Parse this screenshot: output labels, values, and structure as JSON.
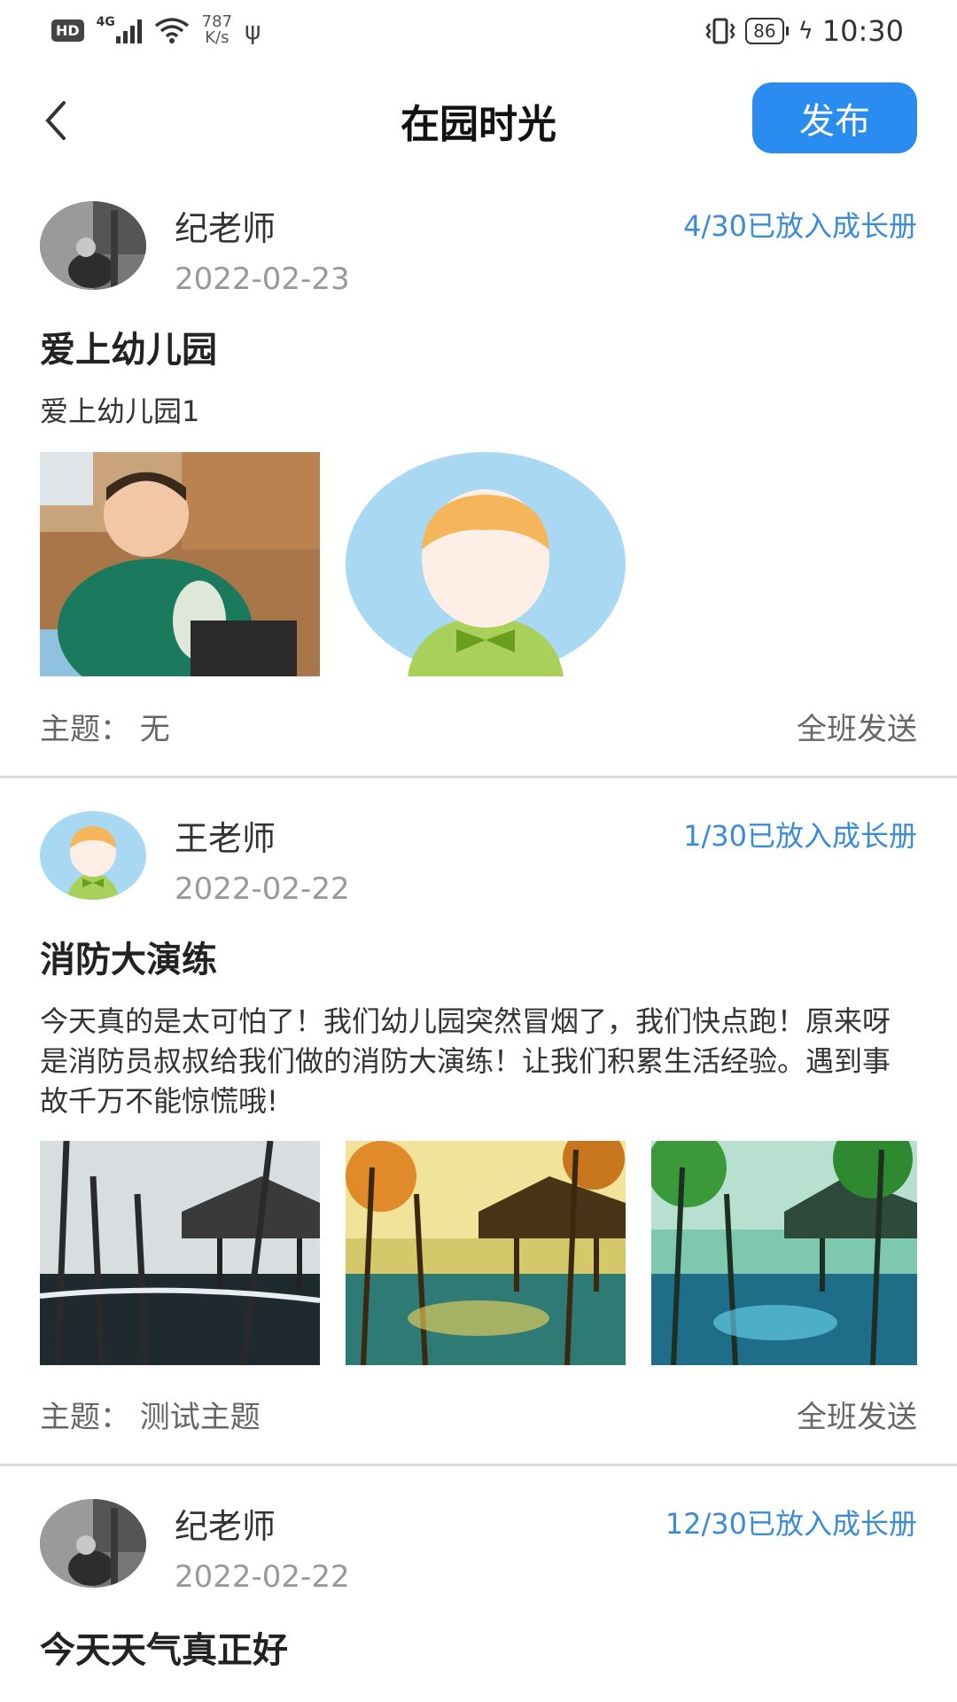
{
  "status_bar": {
    "hd": "HD",
    "network": "4G",
    "speed_value": "787",
    "speed_unit": "K/s",
    "battery": "86",
    "time": "10:30"
  },
  "nav": {
    "title": "在园时光",
    "publish_label": "发布"
  },
  "posts": [
    {
      "author": "纪老师",
      "date": "2022-02-23",
      "growth": "4/30已放入成长册",
      "title": "爱上幼儿园",
      "body": "爱上幼儿园1",
      "topic": "主题：  无",
      "scope": "全班发送"
    },
    {
      "author": "王老师",
      "date": "2022-02-22",
      "growth": "1/30已放入成长册",
      "title": "消防大演练",
      "body": "今天真的是太可怕了！我们幼儿园突然冒烟了，我们快点跑！原来呀是消防员叔叔给我们做的消防大演练！让我们积累生活经验。遇到事故千万不能惊慌哦!",
      "topic": "主题：  测试主题",
      "scope": "全班发送"
    },
    {
      "author": "纪老师",
      "date": "2022-02-22",
      "growth": "12/30已放入成长册",
      "title": "今天天气真正好"
    }
  ],
  "colors": {
    "accent": "#2a8cf0",
    "growth_text": "#3a8bd8",
    "divider": "#dcdcdc"
  }
}
